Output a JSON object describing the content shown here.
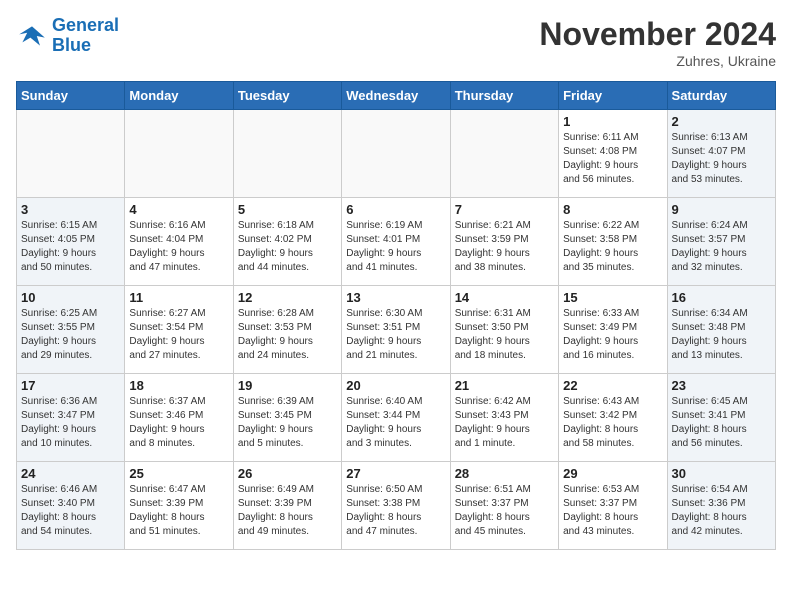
{
  "logo": {
    "line1": "General",
    "line2": "Blue"
  },
  "title": "November 2024",
  "subtitle": "Zuhres, Ukraine",
  "days_of_week": [
    "Sunday",
    "Monday",
    "Tuesday",
    "Wednesday",
    "Thursday",
    "Friday",
    "Saturday"
  ],
  "weeks": [
    [
      {
        "day": "",
        "detail": ""
      },
      {
        "day": "",
        "detail": ""
      },
      {
        "day": "",
        "detail": ""
      },
      {
        "day": "",
        "detail": ""
      },
      {
        "day": "",
        "detail": ""
      },
      {
        "day": "1",
        "detail": "Sunrise: 6:11 AM\nSunset: 4:08 PM\nDaylight: 9 hours\nand 56 minutes."
      },
      {
        "day": "2",
        "detail": "Sunrise: 6:13 AM\nSunset: 4:07 PM\nDaylight: 9 hours\nand 53 minutes."
      }
    ],
    [
      {
        "day": "3",
        "detail": "Sunrise: 6:15 AM\nSunset: 4:05 PM\nDaylight: 9 hours\nand 50 minutes."
      },
      {
        "day": "4",
        "detail": "Sunrise: 6:16 AM\nSunset: 4:04 PM\nDaylight: 9 hours\nand 47 minutes."
      },
      {
        "day": "5",
        "detail": "Sunrise: 6:18 AM\nSunset: 4:02 PM\nDaylight: 9 hours\nand 44 minutes."
      },
      {
        "day": "6",
        "detail": "Sunrise: 6:19 AM\nSunset: 4:01 PM\nDaylight: 9 hours\nand 41 minutes."
      },
      {
        "day": "7",
        "detail": "Sunrise: 6:21 AM\nSunset: 3:59 PM\nDaylight: 9 hours\nand 38 minutes."
      },
      {
        "day": "8",
        "detail": "Sunrise: 6:22 AM\nSunset: 3:58 PM\nDaylight: 9 hours\nand 35 minutes."
      },
      {
        "day": "9",
        "detail": "Sunrise: 6:24 AM\nSunset: 3:57 PM\nDaylight: 9 hours\nand 32 minutes."
      }
    ],
    [
      {
        "day": "10",
        "detail": "Sunrise: 6:25 AM\nSunset: 3:55 PM\nDaylight: 9 hours\nand 29 minutes."
      },
      {
        "day": "11",
        "detail": "Sunrise: 6:27 AM\nSunset: 3:54 PM\nDaylight: 9 hours\nand 27 minutes."
      },
      {
        "day": "12",
        "detail": "Sunrise: 6:28 AM\nSunset: 3:53 PM\nDaylight: 9 hours\nand 24 minutes."
      },
      {
        "day": "13",
        "detail": "Sunrise: 6:30 AM\nSunset: 3:51 PM\nDaylight: 9 hours\nand 21 minutes."
      },
      {
        "day": "14",
        "detail": "Sunrise: 6:31 AM\nSunset: 3:50 PM\nDaylight: 9 hours\nand 18 minutes."
      },
      {
        "day": "15",
        "detail": "Sunrise: 6:33 AM\nSunset: 3:49 PM\nDaylight: 9 hours\nand 16 minutes."
      },
      {
        "day": "16",
        "detail": "Sunrise: 6:34 AM\nSunset: 3:48 PM\nDaylight: 9 hours\nand 13 minutes."
      }
    ],
    [
      {
        "day": "17",
        "detail": "Sunrise: 6:36 AM\nSunset: 3:47 PM\nDaylight: 9 hours\nand 10 minutes."
      },
      {
        "day": "18",
        "detail": "Sunrise: 6:37 AM\nSunset: 3:46 PM\nDaylight: 9 hours\nand 8 minutes."
      },
      {
        "day": "19",
        "detail": "Sunrise: 6:39 AM\nSunset: 3:45 PM\nDaylight: 9 hours\nand 5 minutes."
      },
      {
        "day": "20",
        "detail": "Sunrise: 6:40 AM\nSunset: 3:44 PM\nDaylight: 9 hours\nand 3 minutes."
      },
      {
        "day": "21",
        "detail": "Sunrise: 6:42 AM\nSunset: 3:43 PM\nDaylight: 9 hours\nand 1 minute."
      },
      {
        "day": "22",
        "detail": "Sunrise: 6:43 AM\nSunset: 3:42 PM\nDaylight: 8 hours\nand 58 minutes."
      },
      {
        "day": "23",
        "detail": "Sunrise: 6:45 AM\nSunset: 3:41 PM\nDaylight: 8 hours\nand 56 minutes."
      }
    ],
    [
      {
        "day": "24",
        "detail": "Sunrise: 6:46 AM\nSunset: 3:40 PM\nDaylight: 8 hours\nand 54 minutes."
      },
      {
        "day": "25",
        "detail": "Sunrise: 6:47 AM\nSunset: 3:39 PM\nDaylight: 8 hours\nand 51 minutes."
      },
      {
        "day": "26",
        "detail": "Sunrise: 6:49 AM\nSunset: 3:39 PM\nDaylight: 8 hours\nand 49 minutes."
      },
      {
        "day": "27",
        "detail": "Sunrise: 6:50 AM\nSunset: 3:38 PM\nDaylight: 8 hours\nand 47 minutes."
      },
      {
        "day": "28",
        "detail": "Sunrise: 6:51 AM\nSunset: 3:37 PM\nDaylight: 8 hours\nand 45 minutes."
      },
      {
        "day": "29",
        "detail": "Sunrise: 6:53 AM\nSunset: 3:37 PM\nDaylight: 8 hours\nand 43 minutes."
      },
      {
        "day": "30",
        "detail": "Sunrise: 6:54 AM\nSunset: 3:36 PM\nDaylight: 8 hours\nand 42 minutes."
      }
    ]
  ]
}
